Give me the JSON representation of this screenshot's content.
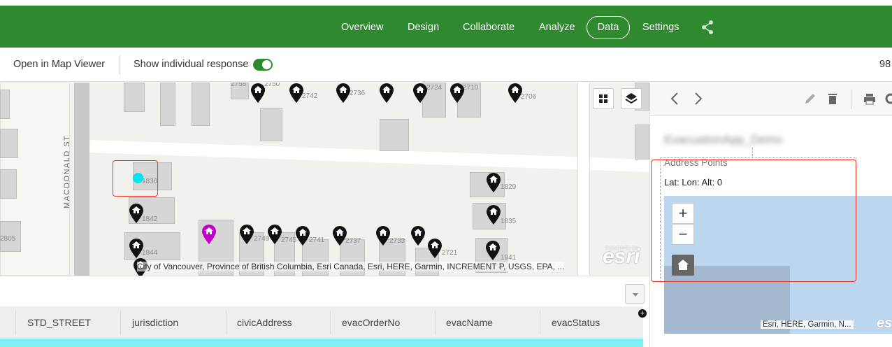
{
  "nav": {
    "items": [
      "Overview",
      "Design",
      "Collaborate",
      "Analyze"
    ],
    "active": "Data",
    "settings": "Settings",
    "share_icon": "share-icon",
    "color": "#2f8a2f"
  },
  "toolbar": {
    "open_map_viewer": "Open in Map Viewer",
    "show_individual": "Show individual response",
    "toggle_on": true,
    "count": "98"
  },
  "map": {
    "street_label": "MACDONALD ST",
    "addresses": [
      "1836",
      "1842",
      "1844",
      "2805",
      "2749",
      "2745",
      "2741",
      "2737",
      "2733",
      "2721",
      "2742",
      "2736",
      "2724",
      "2710",
      "2706",
      "2758",
      "2750",
      "1829",
      "1835",
      "1841"
    ],
    "attribution": "City of Vancouver, Province of British Columbia, Esri Canada, Esri, HERE, Garmin, INCREMENT P, USGS, EPA, ...",
    "esri_powered": "POWERED BY",
    "esri_logo": "esri",
    "selected_color": "#00e5f0",
    "highlight_pin_color": "#c000c8"
  },
  "grid": {
    "columns": [
      "STD_STREET",
      "jurisdiction",
      "civicAddress",
      "evacOrderNo",
      "evacName",
      "evacStatus"
    ],
    "plus": "+"
  },
  "panel": {
    "blurred_title": "EvacuationApp_Demo",
    "section_label": "Address Points",
    "latlon": "Lat:  Lon:  Alt: 0",
    "zoom_in": "+",
    "zoom_out": "−",
    "attribution": "Esri, HERE, Garmin, N...",
    "esri": "esri"
  }
}
